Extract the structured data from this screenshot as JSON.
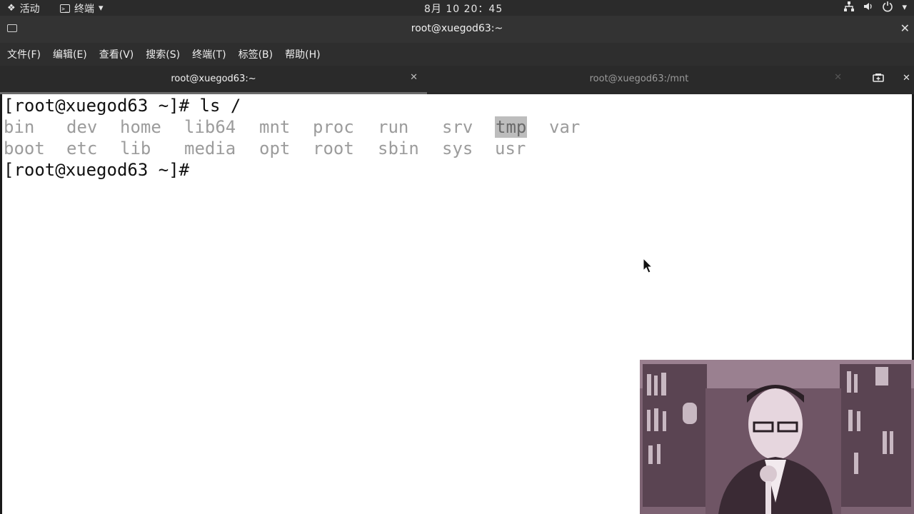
{
  "topbar": {
    "activities_label": "活动",
    "app_label": "终端",
    "clock": "8月 10 20：45",
    "icons": [
      "network-icon",
      "volume-icon",
      "power-icon"
    ]
  },
  "window": {
    "title": "root@xuegod63:~"
  },
  "menu": [
    "文件(F)",
    "编辑(E)",
    "查看(V)",
    "搜索(S)",
    "终端(T)",
    "标签(B)",
    "帮助(H)"
  ],
  "tabs": [
    {
      "label": "root@xuegod63:~",
      "active": true
    },
    {
      "label": "root@xuegod63:/mnt",
      "active": false
    }
  ],
  "terminal": {
    "lines": [
      "[root@xuegod63 ~]# ls /",
      "[root@xuegod63 ~]#"
    ],
    "dirs_row1": [
      "bin",
      "dev",
      "home",
      "lib64",
      "mnt",
      "proc",
      "run",
      "srv",
      "tmp",
      "var"
    ],
    "dirs_row2": [
      "boot",
      "etc",
      "lib",
      "media",
      "opt",
      "root",
      "sbin",
      "sys",
      "usr"
    ],
    "highlighted": "tmp"
  },
  "colors": {
    "topbar_bg": "#2b2b2b",
    "chrome_bg": "#2e2e2e",
    "dir_text": "#9c9c9c",
    "highlight_bg": "#bdbdbd"
  }
}
